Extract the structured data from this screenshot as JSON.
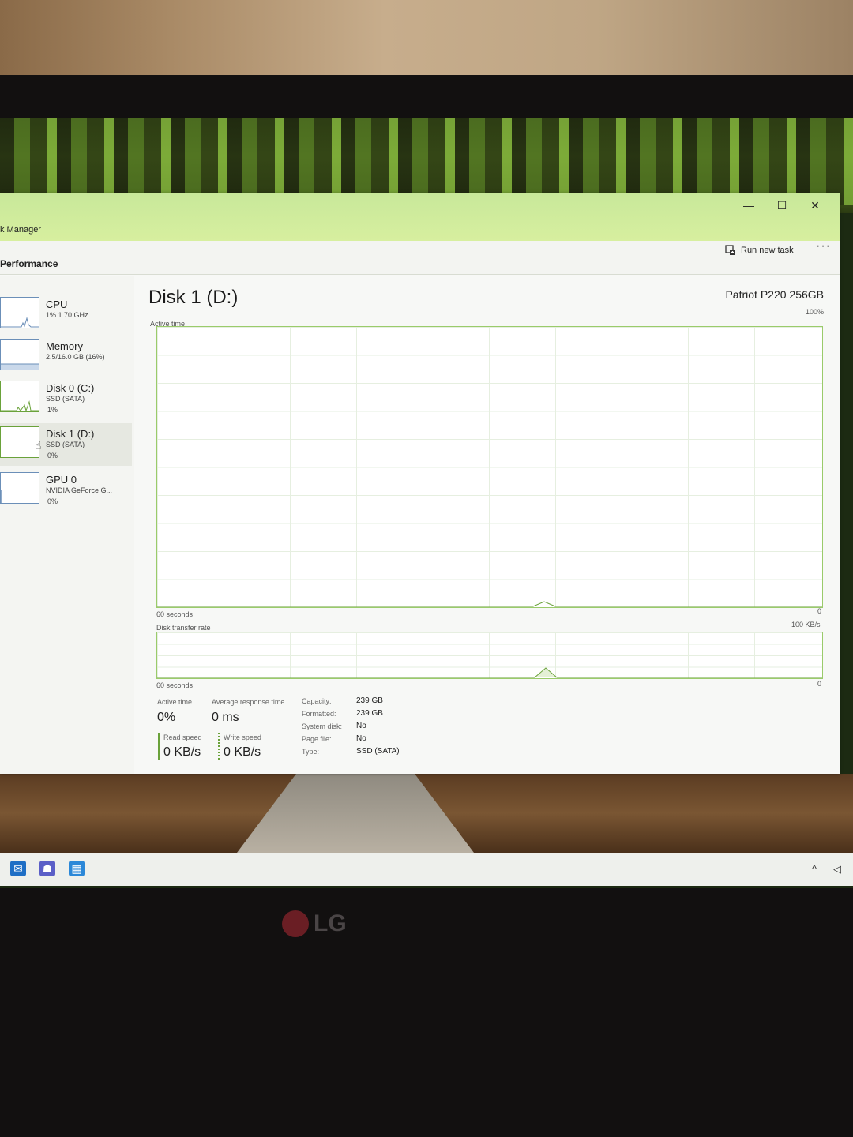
{
  "window": {
    "title": "k Manager",
    "controls": {
      "minimize": "—",
      "maximize": "☐",
      "close": "✕"
    }
  },
  "toolbar": {
    "section": "Performance",
    "run_new_task": "Run new task",
    "more": "···"
  },
  "sidebar": {
    "items": [
      {
        "name": "CPU",
        "sub": "1% 1.70 GHz",
        "sub2": ""
      },
      {
        "name": "Memory",
        "sub": "2.5/16.0 GB (16%)",
        "sub2": ""
      },
      {
        "name": "Disk 0 (C:)",
        "sub": "SSD (SATA)",
        "sub2": "1%"
      },
      {
        "name": "Disk 1 (D:)",
        "sub": "SSD (SATA)",
        "sub2": "0%"
      },
      {
        "name": "GPU 0",
        "sub": "NVIDIA GeForce G...",
        "sub2": "0%"
      }
    ],
    "selected_index": 3
  },
  "main": {
    "title": "Disk 1 (D:)",
    "model": "Patriot P220 256GB",
    "active_time_chart": {
      "label": "Active time",
      "max_label": "100%",
      "min_label": "0",
      "duration_label": "60 seconds"
    },
    "transfer_chart": {
      "label": "Disk transfer rate",
      "max_label": "100 KB/s",
      "min_label": "0",
      "duration_label": "60 seconds"
    },
    "stats": {
      "active_time_label": "Active time",
      "active_time_value": "0%",
      "avg_response_label": "Average response time",
      "avg_response_value": "0 ms",
      "read_speed_label": "Read speed",
      "read_speed_value": "0 KB/s",
      "write_speed_label": "Write speed",
      "write_speed_value": "0 KB/s"
    },
    "properties": [
      {
        "label": "Capacity:",
        "value": "239 GB"
      },
      {
        "label": "Formatted:",
        "value": "239 GB"
      },
      {
        "label": "System disk:",
        "value": "No"
      },
      {
        "label": "Page file:",
        "value": "No"
      },
      {
        "label": "Type:",
        "value": "SSD (SATA)"
      }
    ]
  },
  "taskbar": {
    "icons": [
      "outlook-icon",
      "teams-icon",
      "photos-icon"
    ],
    "tray": {
      "chevron": "^",
      "arrow": "◁"
    }
  },
  "monitor": {
    "brand": "LG"
  },
  "colors": {
    "titlebar": "#d7ef9f",
    "accent_green": "#6aa23a",
    "cpu_blue": "#6b8fb8"
  }
}
